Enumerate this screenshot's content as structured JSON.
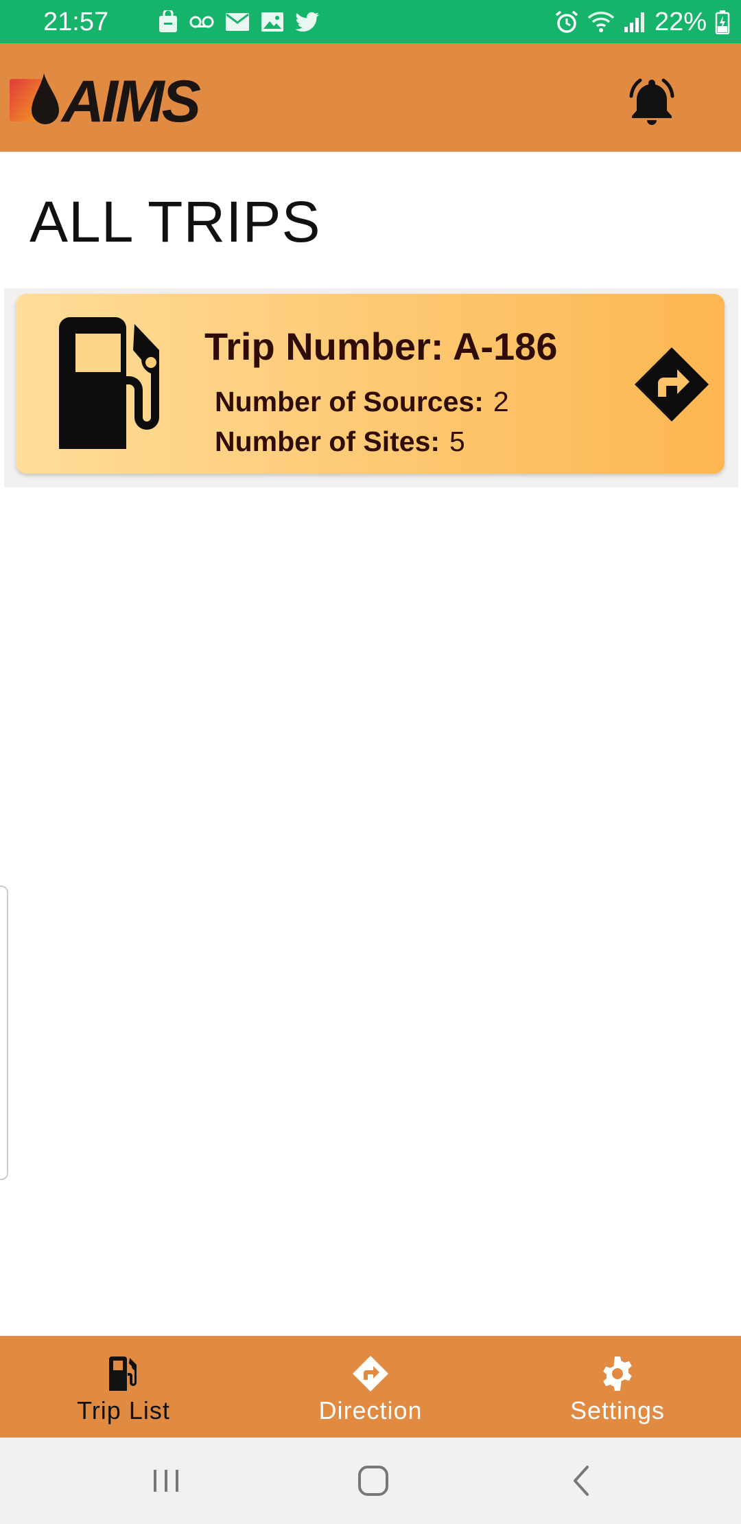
{
  "status_bar": {
    "time": "21:57",
    "battery": "22%",
    "left_icons": [
      "shopping-bag-icon",
      "voicemail-icon",
      "email-icon",
      "gallery-icon",
      "twitter-icon"
    ],
    "right_icons": [
      "alarm-icon",
      "wifi-icon",
      "signal-icon",
      "battery-charging-icon"
    ]
  },
  "header": {
    "logo_text": "AIMS",
    "notification_icon": "bell-icon"
  },
  "page": {
    "title": "ALL TRIPS"
  },
  "trips": [
    {
      "title": "Trip Number: A-186",
      "sources_label": "Number of Sources:",
      "sources_value": "2",
      "sites_label": "Number of Sites:",
      "sites_value": "5",
      "icon": "fuel-pump-icon",
      "action_icon": "direction-icon"
    }
  ],
  "bottom_nav": {
    "items": [
      {
        "label": "Trip List",
        "icon": "fuel-pump-icon",
        "active": true
      },
      {
        "label": "Direction",
        "icon": "direction-icon",
        "active": false
      },
      {
        "label": "Settings",
        "icon": "gear-icon",
        "active": false
      }
    ]
  },
  "system_nav": {
    "buttons": [
      "recent-apps-icon",
      "home-icon",
      "back-icon"
    ]
  },
  "colors": {
    "status_bar": "#16b36a",
    "header": "#e08a42",
    "card_gradient_start": "#ffdd9a",
    "card_gradient_end": "#fdb651",
    "card_text": "#2f0d06",
    "bottom_nav": "#e08a42"
  }
}
